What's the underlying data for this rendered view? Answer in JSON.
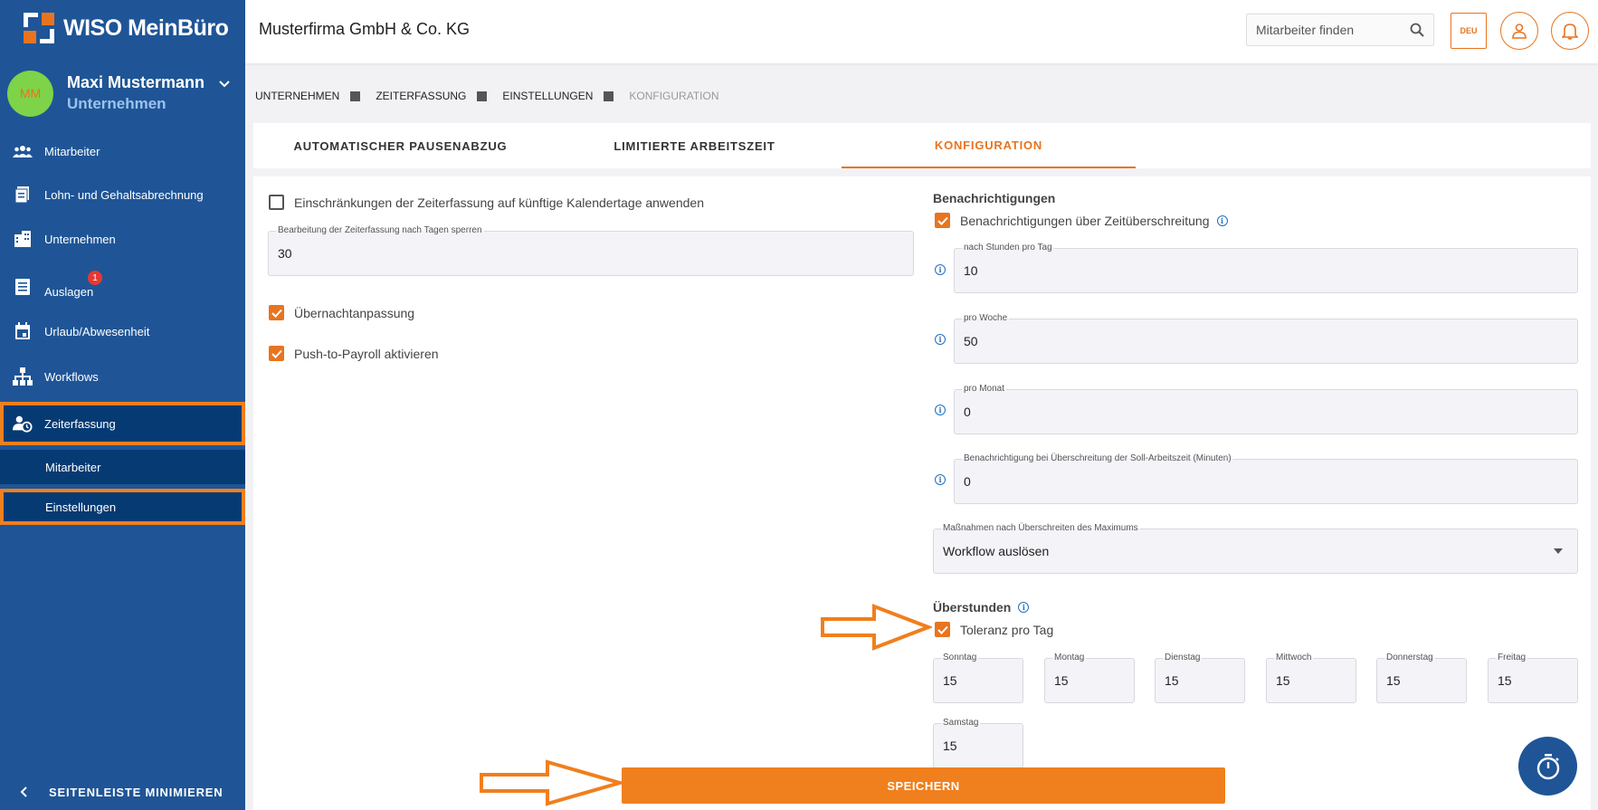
{
  "app": {
    "logo_text": "WISO MeinBüro"
  },
  "user": {
    "initials": "MM",
    "name": "Maxi Mustermann",
    "role": "Unternehmen"
  },
  "sidebar": {
    "items": [
      {
        "label": "Mitarbeiter",
        "icon": "people-icon"
      },
      {
        "label": "Lohn- und Gehaltsabrechnung",
        "icon": "payroll-icon"
      },
      {
        "label": "Unternehmen",
        "icon": "building-icon"
      },
      {
        "label": "Auslagen",
        "icon": "receipt-icon",
        "badge": "1"
      },
      {
        "label": "Urlaub/Abwesenheit",
        "icon": "calendar-icon"
      },
      {
        "label": "Workflows",
        "icon": "workflow-icon"
      },
      {
        "label": "Zeiterfassung",
        "icon": "time-tracking-icon"
      }
    ],
    "sub_items": [
      {
        "label": "Mitarbeiter"
      },
      {
        "label": "Einstellungen"
      }
    ],
    "minimize_label": "SEITENLEISTE MINIMIEREN"
  },
  "header": {
    "company": "Musterfirma GmbH & Co. KG",
    "search_placeholder": "Mitarbeiter finden",
    "language": "DEU"
  },
  "breadcrumb": [
    "UNTERNEHMEN",
    "ZEITERFASSUNG",
    "EINSTELLUNGEN",
    "KONFIGURATION"
  ],
  "tabs": [
    {
      "label": "AUTOMATISCHER PAUSENABZUG"
    },
    {
      "label": "LIMITIERTE ARBEITSZEIT"
    },
    {
      "label": "KONFIGURATION"
    }
  ],
  "left": {
    "restrict_future_label": "Einschränkungen der Zeiterfassung auf künftige Kalendertage anwenden",
    "lock_days_label": "Bearbeitung der Zeiterfassung nach Tagen sperren",
    "lock_days_value": "30",
    "overnight_label": "Übernachtanpassung",
    "push_payroll_label": "Push-to-Payroll aktivieren"
  },
  "notifications": {
    "title": "Benachrichtigungen",
    "overtime_notify_label": "Benachrichtigungen über Zeitüberschreitung",
    "fields": [
      {
        "label": "nach Stunden pro Tag",
        "value": "10"
      },
      {
        "label": "pro Woche",
        "value": "50"
      },
      {
        "label": "pro Monat",
        "value": "0"
      },
      {
        "label": "Benachrichtigung bei Überschreitung der Soll-Arbeitszeit (Minuten)",
        "value": "0"
      }
    ],
    "measures_label": "Maßnahmen nach Überschreiten des Maximums",
    "measures_value": "Workflow auslösen"
  },
  "overtime": {
    "title": "Überstunden",
    "tolerance_label": "Toleranz pro Tag",
    "days": [
      {
        "label": "Sonntag",
        "value": "15"
      },
      {
        "label": "Montag",
        "value": "15"
      },
      {
        "label": "Dienstag",
        "value": "15"
      },
      {
        "label": "Mittwoch",
        "value": "15"
      },
      {
        "label": "Donnerstag",
        "value": "15"
      },
      {
        "label": "Freitag",
        "value": "15"
      },
      {
        "label": "Samstag",
        "value": "15"
      }
    ]
  },
  "save_label": "SPEICHERN",
  "colors": {
    "sidebar": "#1f5596",
    "sidebar_active": "#063a73",
    "accent": "#f07f1d",
    "info": "#1f6fc0"
  }
}
